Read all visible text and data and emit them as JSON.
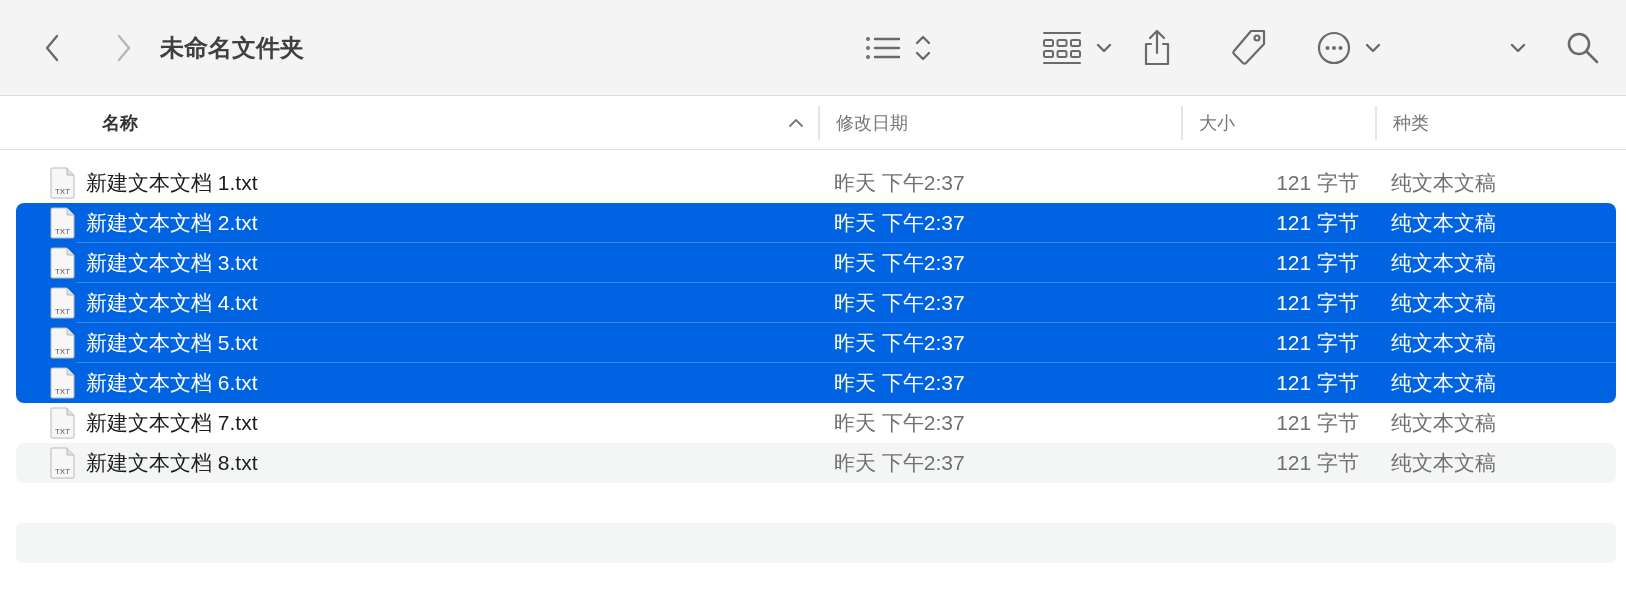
{
  "toolbar": {
    "title": "未命名文件夹",
    "back_disabled": false,
    "forward_disabled": true
  },
  "columns": [
    {
      "label": "名称",
      "sorted": true
    },
    {
      "label": "修改日期",
      "sorted": false
    },
    {
      "label": "大小",
      "sorted": false
    },
    {
      "label": "种类",
      "sorted": false
    }
  ],
  "rows": [
    {
      "name": "新建文本文档 1.txt",
      "icon_label": "TXT",
      "date": "昨天 下午2:37",
      "size": "121 字节",
      "kind": "纯文本文稿",
      "selected": false
    },
    {
      "name": "新建文本文档 2.txt",
      "icon_label": "TXT",
      "date": "昨天 下午2:37",
      "size": "121 字节",
      "kind": "纯文本文稿",
      "selected": true
    },
    {
      "name": "新建文本文档 3.txt",
      "icon_label": "TXT",
      "date": "昨天 下午2:37",
      "size": "121 字节",
      "kind": "纯文本文稿",
      "selected": true
    },
    {
      "name": "新建文本文档 4.txt",
      "icon_label": "TXT",
      "date": "昨天 下午2:37",
      "size": "121 字节",
      "kind": "纯文本文稿",
      "selected": true
    },
    {
      "name": "新建文本文档 5.txt",
      "icon_label": "TXT",
      "date": "昨天 下午2:37",
      "size": "121 字节",
      "kind": "纯文本文稿",
      "selected": true
    },
    {
      "name": "新建文本文档 6.txt",
      "icon_label": "TXT",
      "date": "昨天 下午2:37",
      "size": "121 字节",
      "kind": "纯文本文稿",
      "selected": true
    },
    {
      "name": "新建文本文档 7.txt",
      "icon_label": "TXT",
      "date": "昨天 下午2:37",
      "size": "121 字节",
      "kind": "纯文本文稿",
      "selected": false
    },
    {
      "name": "新建文本文档 8.txt",
      "icon_label": "TXT",
      "date": "昨天 下午2:37",
      "size": "121 字节",
      "kind": "纯文本文稿",
      "selected": false
    }
  ]
}
